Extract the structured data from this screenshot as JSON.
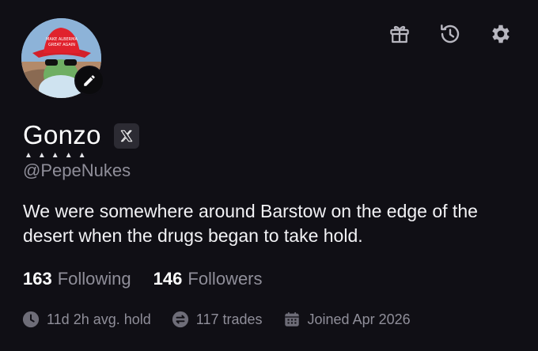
{
  "profile": {
    "name": "Gonzo",
    "name_marks": "▲▲▲▲▲",
    "handle": "@PepeNukes",
    "bio": "We were somewhere around Barstow on the edge of the desert when the drugs began to take hold.",
    "avatar_hat_text_1": "MAKE ALBERMA",
    "avatar_hat_text_2": "GREAT AGAIN"
  },
  "icons": {
    "gift": "gift-icon",
    "history": "history-icon",
    "settings": "gear-icon",
    "edit": "pencil-icon",
    "x": "x-logo-icon"
  },
  "follow": {
    "following_count": "163",
    "following_label": "Following",
    "followers_count": "146",
    "followers_label": "Followers"
  },
  "stats": {
    "hold": "11d 2h avg. hold",
    "trades": "117 trades",
    "joined": "Joined Apr 2026"
  },
  "colors": {
    "background": "#100f15",
    "muted_text": "#8f8e99",
    "icon_gray": "#b8b7c0"
  }
}
